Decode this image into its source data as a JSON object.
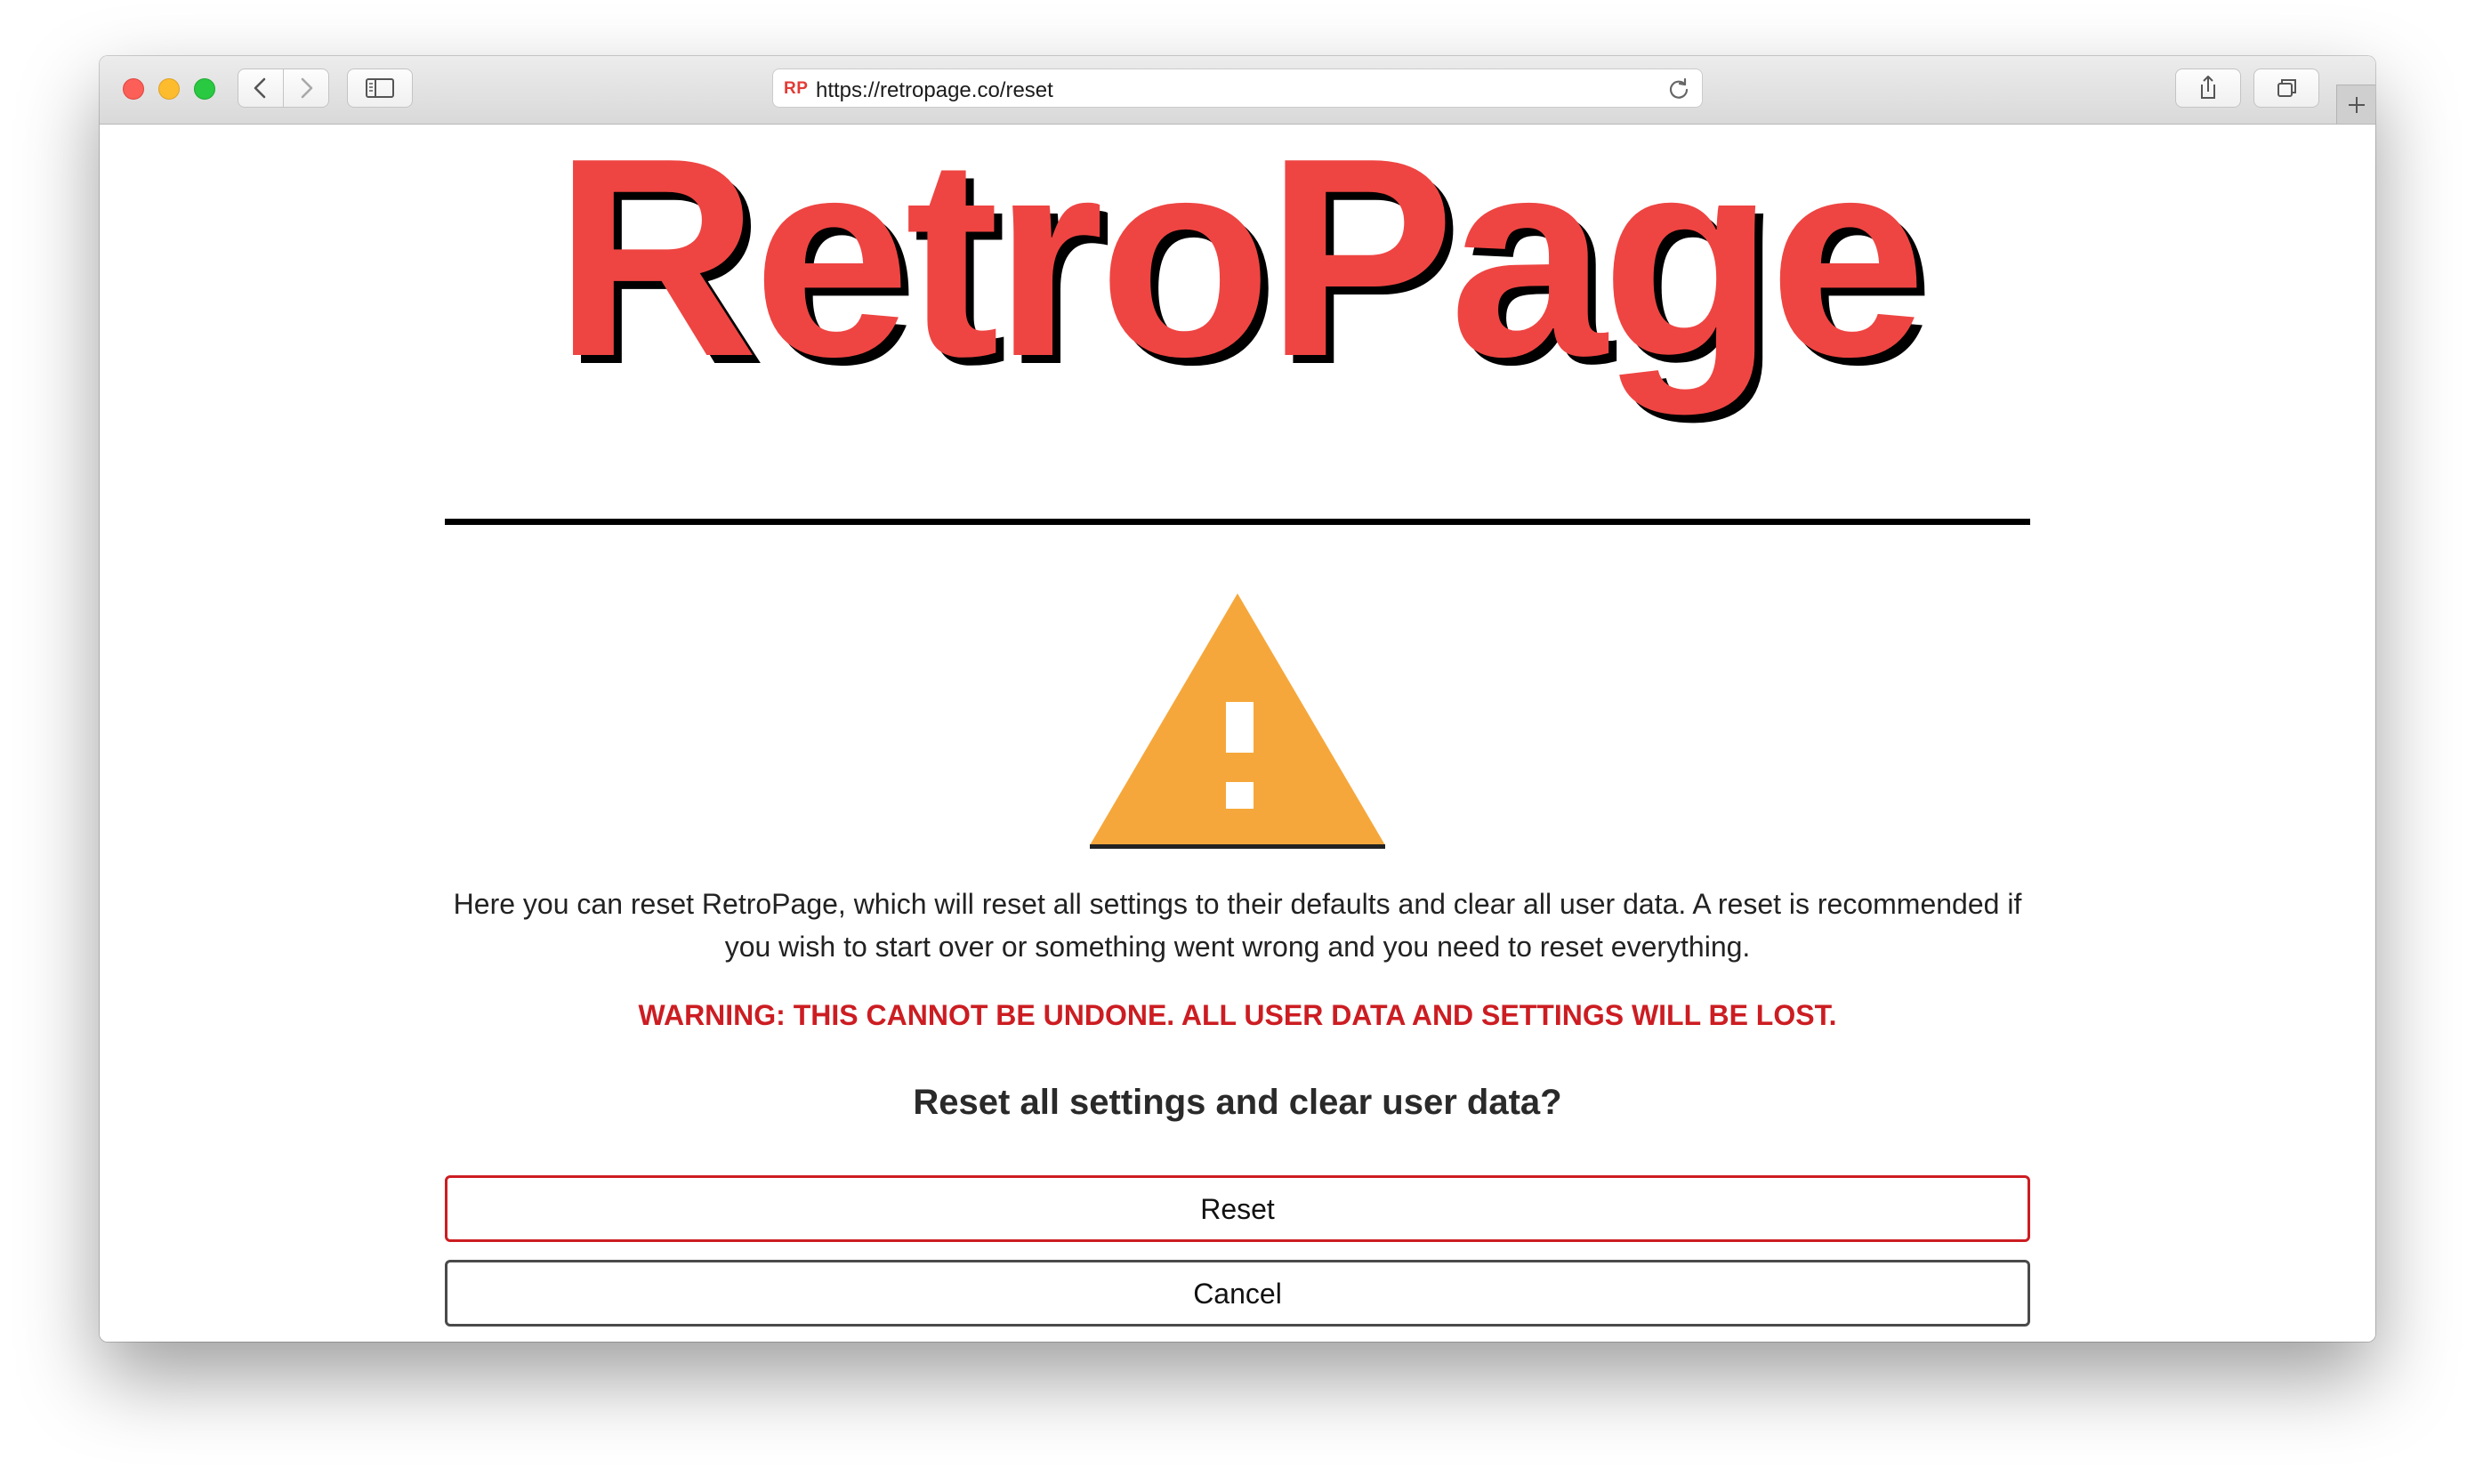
{
  "browser": {
    "url": "https://retropage.co/reset",
    "favicon_text": "RP",
    "icons": {
      "back": "chevron-left-icon",
      "forward": "chevron-right-icon",
      "sidebar": "sidebar-icon",
      "reload": "reload-icon",
      "share": "share-icon",
      "tabs": "tabs-icon",
      "new_tab": "plus-icon"
    }
  },
  "page": {
    "logo": "RetroPage",
    "warning_icon": "warning-triangle-icon",
    "description": "Here you can reset RetroPage, which will reset all settings to their defaults and clear all user data. A reset is recommended if you wish to start over or something went wrong and you need to reset everything.",
    "warning": "WARNING: THIS CANNOT BE UNDONE. ALL USER DATA AND SETTINGS WILL BE LOST.",
    "question": "Reset all settings and clear user data?",
    "reset_label": "Reset",
    "cancel_label": "Cancel"
  },
  "colors": {
    "logo": "#ee4542",
    "warning_triangle": "#f6a73b",
    "warning_text": "#cc1d22",
    "reset_border": "#cc1d22",
    "cancel_border": "#4a4a4a"
  }
}
